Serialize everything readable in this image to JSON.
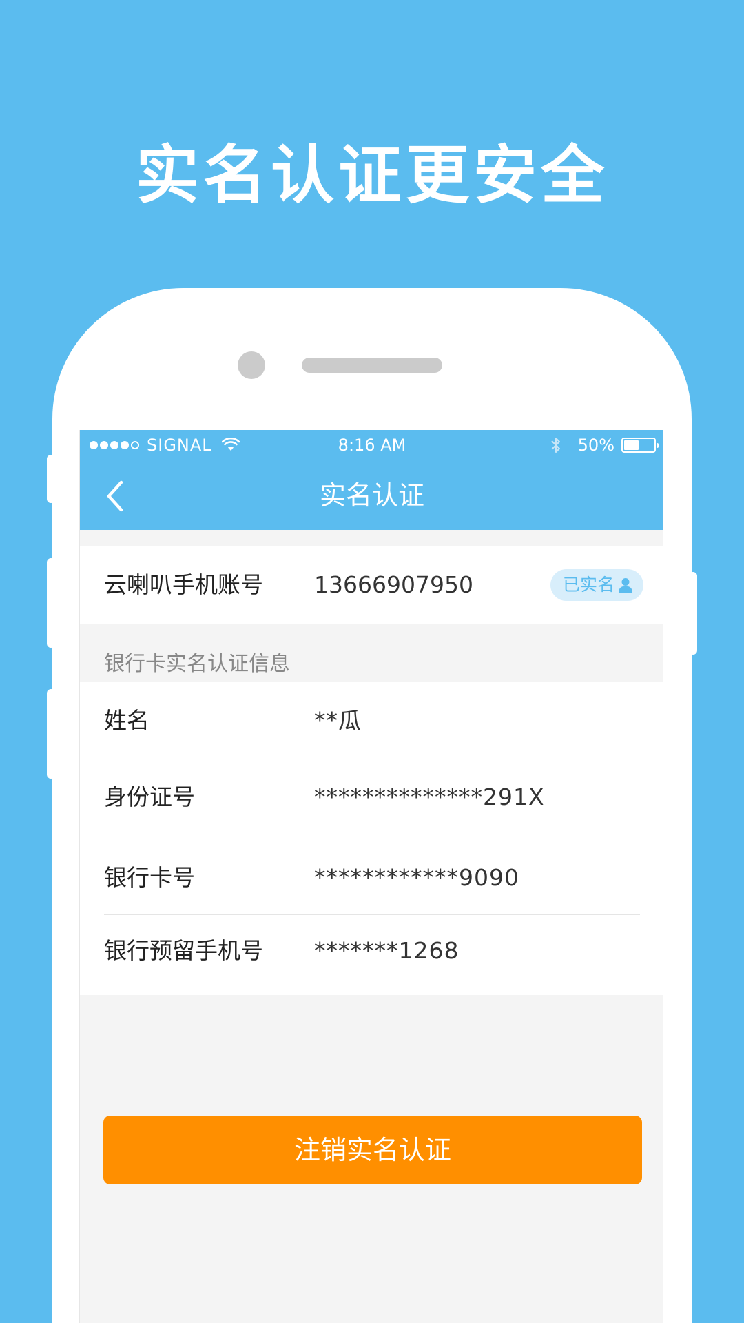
{
  "headline": "实名认证更安全",
  "status_bar": {
    "carrier": "SIGNAL",
    "time": "8:16 AM",
    "battery": "50%",
    "battery_level": 0.5,
    "signal_icon": "signal-dots-icon",
    "wifi_icon": "wifi-icon",
    "bluetooth_icon": "bluetooth-icon"
  },
  "nav": {
    "title": "实名认证",
    "back_icon": "chevron-left-icon"
  },
  "account": {
    "label": "云喇叭手机账号",
    "value": "13666907950",
    "badge": "已实名",
    "badge_icon": "user-icon"
  },
  "section": {
    "title": "银行卡实名认证信息"
  },
  "info_rows": [
    {
      "label": "姓名",
      "value": "**瓜"
    },
    {
      "label": "身份证号",
      "value": "**************291X"
    },
    {
      "label": "银行卡号",
      "value": "************9090"
    },
    {
      "label": "银行预留手机号",
      "value": "*******1268"
    }
  ],
  "action": {
    "cancel_label": "注销实名认证"
  },
  "colors": {
    "background": "#5bbcef",
    "accent": "#5bbcef",
    "button": "#ff8f00"
  }
}
